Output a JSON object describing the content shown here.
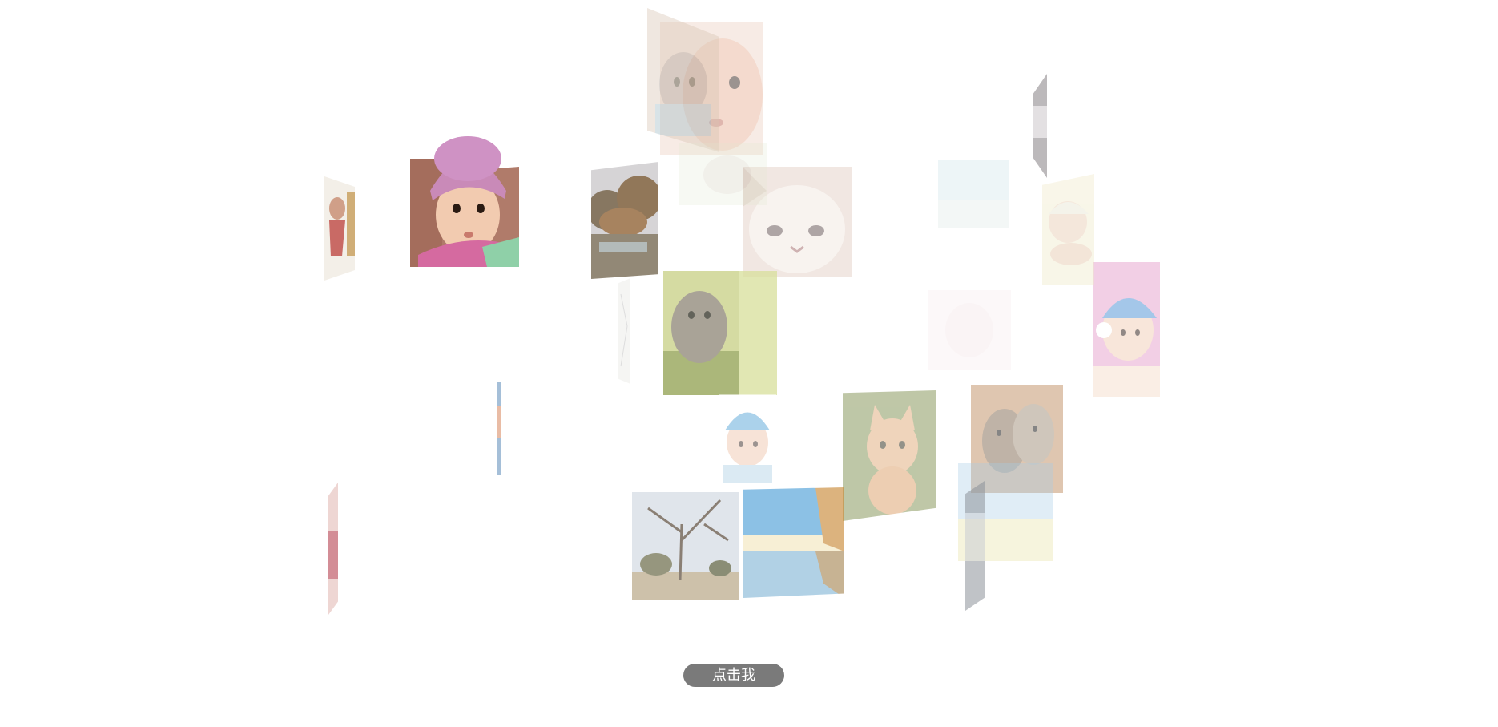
{
  "button": {
    "label": "点击我"
  },
  "tiles": [
    {
      "name": "baby-pink-hat-photo",
      "subject": "baby",
      "opacity": 1.0
    },
    {
      "name": "baby-face-closeup-photo",
      "subject": "baby",
      "opacity": 0.5
    },
    {
      "name": "kitten-overlay-photo",
      "subject": "kitten",
      "opacity": 0.4
    },
    {
      "name": "autumn-forest-painting",
      "subject": "landscape",
      "opacity": 0.75
    },
    {
      "name": "white-persian-cat-photo",
      "subject": "cat",
      "opacity": 0.6
    },
    {
      "name": "kitten-in-grass-photo",
      "subject": "kitten",
      "opacity": 0.75
    },
    {
      "name": "baby-blue-hat-photo",
      "subject": "baby",
      "opacity": 0.5
    },
    {
      "name": "orange-kitten-photo",
      "subject": "kitten",
      "opacity": 0.55
    },
    {
      "name": "two-kittens-photo",
      "subject": "kittens",
      "opacity": 0.55
    },
    {
      "name": "bare-tree-park-photo",
      "subject": "landscape",
      "opacity": 0.7
    },
    {
      "name": "lake-reflection-photo",
      "subject": "landscape",
      "opacity": 0.65
    },
    {
      "name": "baby-headphones-photo",
      "subject": "baby",
      "opacity": 0.55
    },
    {
      "name": "sleeping-baby-photo",
      "subject": "baby",
      "opacity": 0.4
    },
    {
      "name": "baby-girl-thin-photo",
      "subject": "baby",
      "opacity": 0.85
    },
    {
      "name": "meadow-landscape-photo",
      "subject": "landscape",
      "opacity": 0.35
    },
    {
      "name": "pale-sky-photo",
      "subject": "landscape",
      "opacity": 0.2
    },
    {
      "name": "faint-baby-photo",
      "subject": "baby",
      "opacity": 0.1
    },
    {
      "name": "small-cat-strip-photo",
      "subject": "cat",
      "opacity": 0.5
    },
    {
      "name": "blue-sliver-photo",
      "subject": "baby",
      "opacity": 0.7
    },
    {
      "name": "pink-sliver-photo",
      "subject": "baby",
      "opacity": 0.55
    },
    {
      "name": "sketch-sliver-photo",
      "subject": "cat",
      "opacity": 0.3
    },
    {
      "name": "pale-kitten-small-photo",
      "subject": "kitten",
      "opacity": 0.25
    },
    {
      "name": "grey-cat-sliver-photo",
      "subject": "cat",
      "opacity": 0.55
    }
  ]
}
